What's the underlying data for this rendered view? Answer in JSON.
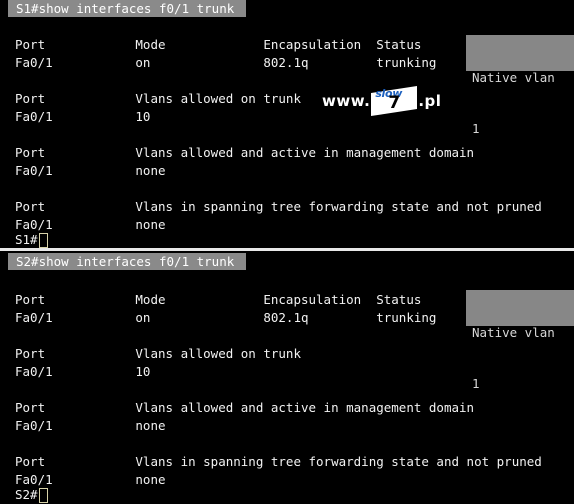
{
  "terminal": {
    "background_color": "#000000",
    "text_color": "#f2f2f2",
    "highlight_color": "#8a8a8a",
    "cursor_color": "#d7d2a8"
  },
  "watermark": {
    "prefix": "www.",
    "logo_text": "slow",
    "logo_number": "7",
    "suffix": ".pl",
    "brand_color": "#1b5fbe"
  },
  "sessions": [
    {
      "command": "S1#show interfaces f0/1 trunk",
      "blocks": [
        {
          "headers": "Port            Mode             Encapsulation  Status",
          "values": "Fa0/1           on               802.1q         trunking",
          "native_header": "Native vlan",
          "native_value": "1"
        },
        {
          "headers": "Port            Vlans allowed on trunk",
          "values": "Fa0/1           10"
        },
        {
          "headers": "Port            Vlans allowed and active in management domain",
          "values": "Fa0/1           none"
        },
        {
          "headers": "Port            Vlans in spanning tree forwarding state and not pruned",
          "values": "Fa0/1           none"
        }
      ],
      "prompt": "S1#"
    },
    {
      "command": "S2#show interfaces f0/1 trunk",
      "blocks": [
        {
          "headers": "Port            Mode             Encapsulation  Status",
          "values": "Fa0/1           on               802.1q         trunking",
          "native_header": "Native vlan",
          "native_value": "1"
        },
        {
          "headers": "Port            Vlans allowed on trunk",
          "values": "Fa0/1           10"
        },
        {
          "headers": "Port            Vlans allowed and active in management domain",
          "values": "Fa0/1           none"
        },
        {
          "headers": "Port            Vlans in spanning tree forwarding state and not pruned",
          "values": "Fa0/1           none"
        }
      ],
      "prompt": "S2#"
    }
  ],
  "columns": {
    "port": "Port",
    "mode": "Mode",
    "encapsulation": "Encapsulation",
    "status": "Status",
    "native_vlan": "Native vlan"
  }
}
